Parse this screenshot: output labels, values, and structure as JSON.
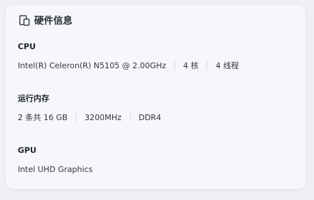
{
  "card": {
    "title": "硬件信息",
    "icon": "device-icon"
  },
  "cpu": {
    "label": "CPU",
    "model": "Intel(R) Celeron(R) N5105 @ 2.00GHz",
    "cores": "4 核",
    "threads": "4 线程"
  },
  "memory": {
    "label": "运行内存",
    "capacity": "2 条共 16 GB",
    "frequency": "3200MHz",
    "type": "DDR4"
  },
  "gpu": {
    "label": "GPU",
    "model": "Intel UHD Graphics"
  },
  "colors": {
    "background": "#eef0f4",
    "card": "#f6f7fb",
    "text": "#1f2329",
    "separator": "#d6d9e0"
  }
}
